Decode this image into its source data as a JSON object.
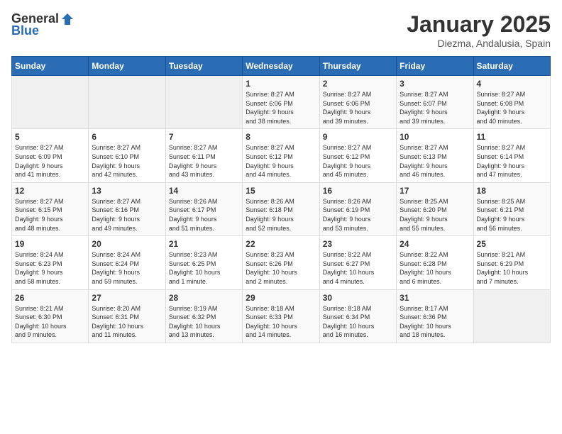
{
  "logo": {
    "general": "General",
    "blue": "Blue"
  },
  "title": {
    "month_year": "January 2025",
    "location": "Diezma, Andalusia, Spain"
  },
  "headers": [
    "Sunday",
    "Monday",
    "Tuesday",
    "Wednesday",
    "Thursday",
    "Friday",
    "Saturday"
  ],
  "weeks": [
    [
      {
        "day": "",
        "info": ""
      },
      {
        "day": "",
        "info": ""
      },
      {
        "day": "",
        "info": ""
      },
      {
        "day": "1",
        "info": "Sunrise: 8:27 AM\nSunset: 6:06 PM\nDaylight: 9 hours\nand 38 minutes."
      },
      {
        "day": "2",
        "info": "Sunrise: 8:27 AM\nSunset: 6:06 PM\nDaylight: 9 hours\nand 39 minutes."
      },
      {
        "day": "3",
        "info": "Sunrise: 8:27 AM\nSunset: 6:07 PM\nDaylight: 9 hours\nand 39 minutes."
      },
      {
        "day": "4",
        "info": "Sunrise: 8:27 AM\nSunset: 6:08 PM\nDaylight: 9 hours\nand 40 minutes."
      }
    ],
    [
      {
        "day": "5",
        "info": "Sunrise: 8:27 AM\nSunset: 6:09 PM\nDaylight: 9 hours\nand 41 minutes."
      },
      {
        "day": "6",
        "info": "Sunrise: 8:27 AM\nSunset: 6:10 PM\nDaylight: 9 hours\nand 42 minutes."
      },
      {
        "day": "7",
        "info": "Sunrise: 8:27 AM\nSunset: 6:11 PM\nDaylight: 9 hours\nand 43 minutes."
      },
      {
        "day": "8",
        "info": "Sunrise: 8:27 AM\nSunset: 6:12 PM\nDaylight: 9 hours\nand 44 minutes."
      },
      {
        "day": "9",
        "info": "Sunrise: 8:27 AM\nSunset: 6:12 PM\nDaylight: 9 hours\nand 45 minutes."
      },
      {
        "day": "10",
        "info": "Sunrise: 8:27 AM\nSunset: 6:13 PM\nDaylight: 9 hours\nand 46 minutes."
      },
      {
        "day": "11",
        "info": "Sunrise: 8:27 AM\nSunset: 6:14 PM\nDaylight: 9 hours\nand 47 minutes."
      }
    ],
    [
      {
        "day": "12",
        "info": "Sunrise: 8:27 AM\nSunset: 6:15 PM\nDaylight: 9 hours\nand 48 minutes."
      },
      {
        "day": "13",
        "info": "Sunrise: 8:27 AM\nSunset: 6:16 PM\nDaylight: 9 hours\nand 49 minutes."
      },
      {
        "day": "14",
        "info": "Sunrise: 8:26 AM\nSunset: 6:17 PM\nDaylight: 9 hours\nand 51 minutes."
      },
      {
        "day": "15",
        "info": "Sunrise: 8:26 AM\nSunset: 6:18 PM\nDaylight: 9 hours\nand 52 minutes."
      },
      {
        "day": "16",
        "info": "Sunrise: 8:26 AM\nSunset: 6:19 PM\nDaylight: 9 hours\nand 53 minutes."
      },
      {
        "day": "17",
        "info": "Sunrise: 8:25 AM\nSunset: 6:20 PM\nDaylight: 9 hours\nand 55 minutes."
      },
      {
        "day": "18",
        "info": "Sunrise: 8:25 AM\nSunset: 6:21 PM\nDaylight: 9 hours\nand 56 minutes."
      }
    ],
    [
      {
        "day": "19",
        "info": "Sunrise: 8:24 AM\nSunset: 6:23 PM\nDaylight: 9 hours\nand 58 minutes."
      },
      {
        "day": "20",
        "info": "Sunrise: 8:24 AM\nSunset: 6:24 PM\nDaylight: 9 hours\nand 59 minutes."
      },
      {
        "day": "21",
        "info": "Sunrise: 8:23 AM\nSunset: 6:25 PM\nDaylight: 10 hours\nand 1 minute."
      },
      {
        "day": "22",
        "info": "Sunrise: 8:23 AM\nSunset: 6:26 PM\nDaylight: 10 hours\nand 2 minutes."
      },
      {
        "day": "23",
        "info": "Sunrise: 8:22 AM\nSunset: 6:27 PM\nDaylight: 10 hours\nand 4 minutes."
      },
      {
        "day": "24",
        "info": "Sunrise: 8:22 AM\nSunset: 6:28 PM\nDaylight: 10 hours\nand 6 minutes."
      },
      {
        "day": "25",
        "info": "Sunrise: 8:21 AM\nSunset: 6:29 PM\nDaylight: 10 hours\nand 7 minutes."
      }
    ],
    [
      {
        "day": "26",
        "info": "Sunrise: 8:21 AM\nSunset: 6:30 PM\nDaylight: 10 hours\nand 9 minutes."
      },
      {
        "day": "27",
        "info": "Sunrise: 8:20 AM\nSunset: 6:31 PM\nDaylight: 10 hours\nand 11 minutes."
      },
      {
        "day": "28",
        "info": "Sunrise: 8:19 AM\nSunset: 6:32 PM\nDaylight: 10 hours\nand 13 minutes."
      },
      {
        "day": "29",
        "info": "Sunrise: 8:18 AM\nSunset: 6:33 PM\nDaylight: 10 hours\nand 14 minutes."
      },
      {
        "day": "30",
        "info": "Sunrise: 8:18 AM\nSunset: 6:34 PM\nDaylight: 10 hours\nand 16 minutes."
      },
      {
        "day": "31",
        "info": "Sunrise: 8:17 AM\nSunset: 6:36 PM\nDaylight: 10 hours\nand 18 minutes."
      },
      {
        "day": "",
        "info": ""
      }
    ]
  ]
}
